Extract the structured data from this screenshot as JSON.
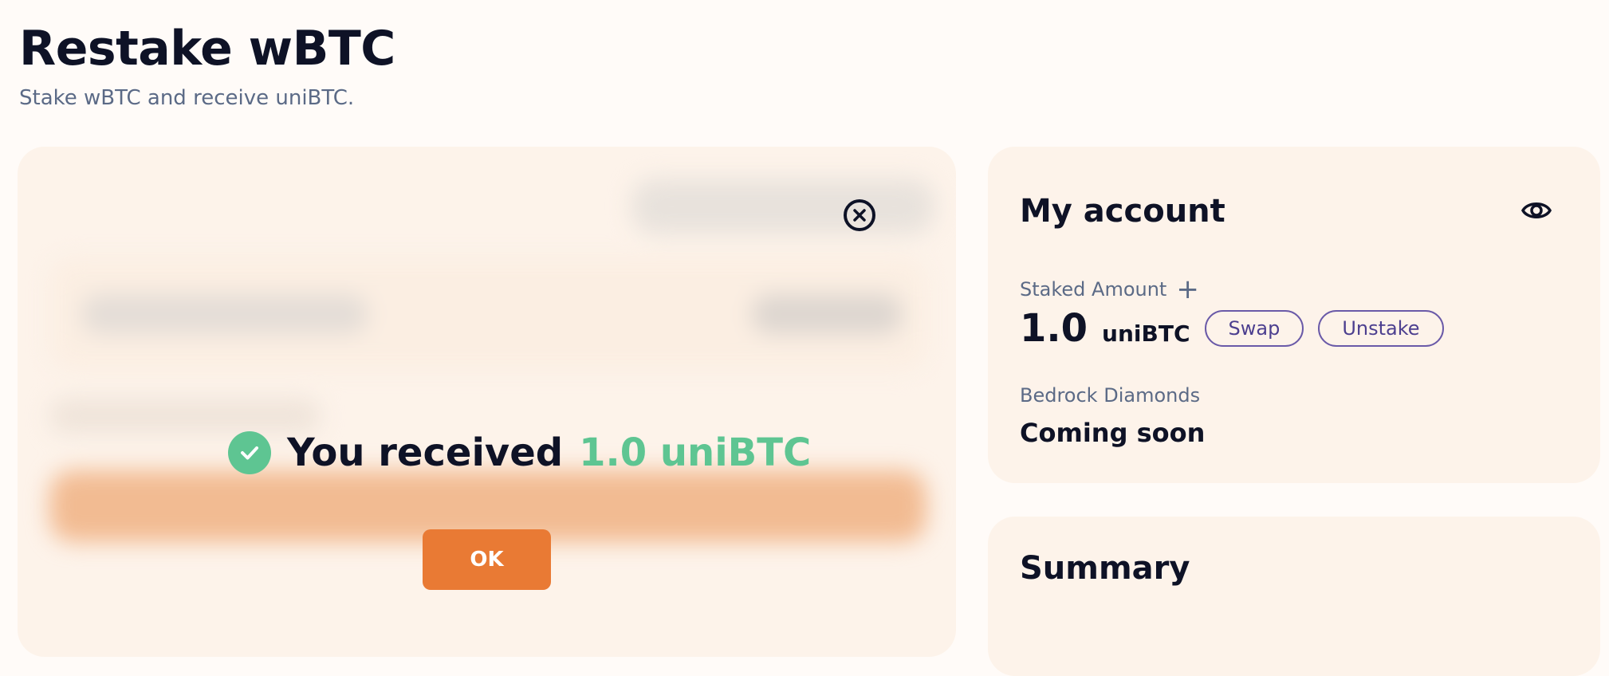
{
  "header": {
    "title": "Restake wBTC",
    "subtitle": "Stake wBTC and receive uniBTC."
  },
  "success_modal": {
    "message": "You received",
    "amount": "1.0 uniBTC",
    "ok_label": "OK"
  },
  "account": {
    "title": "My account",
    "staked_amount_label": "Staked Amount",
    "staked_value": "1.0",
    "staked_unit": "uniBTC",
    "swap_label": "Swap",
    "unstake_label": "Unstake",
    "diamonds_label": "Bedrock Diamonds",
    "diamonds_value": "Coming soon"
  },
  "summary": {
    "title": "Summary"
  },
  "colors": {
    "accent_orange": "#e97a34",
    "success_green": "#5ec592",
    "card_bg": "#fdf3ea",
    "pill_border": "#6a5aa8"
  },
  "icons": [
    "close-icon",
    "check-circle-icon",
    "eye-icon",
    "plus-icon"
  ]
}
